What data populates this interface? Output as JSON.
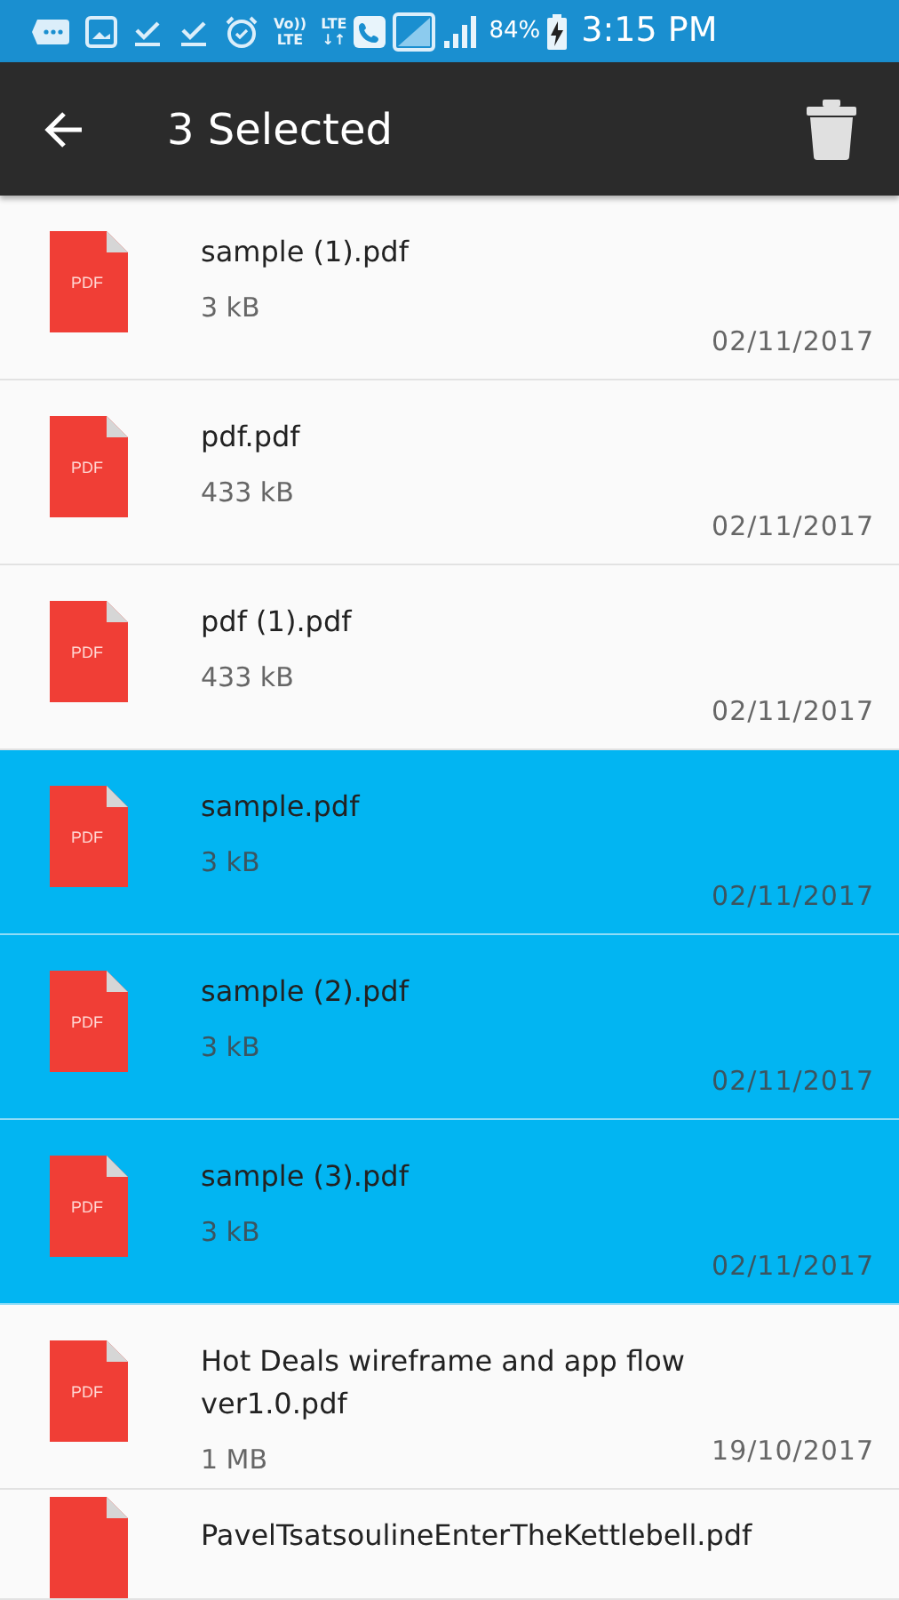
{
  "status_bar": {
    "network_badges": [
      {
        "top": "Vo))",
        "bottom": "LTE"
      },
      {
        "top": "LTE",
        "bottom": "↓↑"
      }
    ],
    "battery": "84%",
    "time": "3:15 PM"
  },
  "toolbar": {
    "title": "3 Selected"
  },
  "files": [
    {
      "icon_label": "PDF",
      "name": "sample (1).pdf",
      "size": "3 kB",
      "date": "02/11/2017",
      "selected": false
    },
    {
      "icon_label": "PDF",
      "name": "pdf.pdf",
      "size": "433 kB",
      "date": "02/11/2017",
      "selected": false
    },
    {
      "icon_label": "PDF",
      "name": "pdf (1).pdf",
      "size": "433 kB",
      "date": "02/11/2017",
      "selected": false
    },
    {
      "icon_label": "PDF",
      "name": "sample.pdf",
      "size": "3 kB",
      "date": "02/11/2017",
      "selected": true
    },
    {
      "icon_label": "PDF",
      "name": "sample (2).pdf",
      "size": "3 kB",
      "date": "02/11/2017",
      "selected": true
    },
    {
      "icon_label": "PDF",
      "name": "sample (3).pdf",
      "size": "3 kB",
      "date": "02/11/2017",
      "selected": true
    },
    {
      "icon_label": "PDF",
      "name": "Hot Deals wireframe and app flow ver1.0.pdf",
      "size": "1 MB",
      "date": "19/10/2017",
      "selected": false
    },
    {
      "name": "PavelTsatsoulineEnterTheKettlebell.pdf",
      "selected": false
    }
  ]
}
